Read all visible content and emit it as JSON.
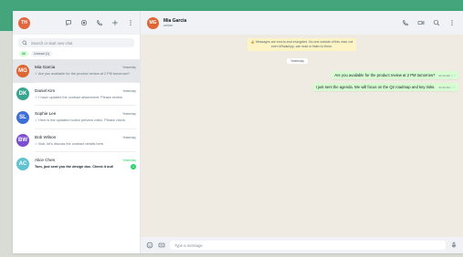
{
  "colors": {
    "brand_band": "#44a57c",
    "accent_green": "#25d366",
    "outgoing_bubble": "#d9fdd3"
  },
  "profile": {
    "initials": "TH",
    "color": "#e2673f"
  },
  "sidebar_icons": [
    "communities-icon",
    "status-icon",
    "calls-icon",
    "new-chat-icon",
    "menu-icon"
  ],
  "search": {
    "placeholder": "Search or start new chat"
  },
  "filters": [
    {
      "label": "All",
      "active": true
    },
    {
      "label": "Unread (1)",
      "active": false
    }
  ],
  "chats": [
    {
      "initials": "MG",
      "color": "#dd6633",
      "name": "Mia Garcia",
      "time": "Yesterday",
      "preview": "✓ Are you available for the product review at 2 PM tomorrow?",
      "selected": true
    },
    {
      "initials": "DK",
      "color": "#3aa58f",
      "name": "Daniel Kim",
      "time": "Yesterday",
      "preview": "✓ I have updated the contract attachment. Please review."
    },
    {
      "initials": "SL",
      "color": "#3f6fd6",
      "name": "Sophie Lee",
      "time": "Yesterday",
      "preview": "✓ Here is the updated motion preview video. Please check."
    },
    {
      "initials": "BW",
      "color": "#7a4fd0",
      "name": "Bob Wilson",
      "time": "Yesterday",
      "preview": "✓ Bob, let's discuss the contract details here."
    },
    {
      "initials": "AC",
      "color": "#5fc4cf",
      "name": "Alice Chen",
      "time": "Yesterday",
      "preview": "Tom, just sent you the design doc. Check it out!",
      "unread": "1"
    }
  ],
  "active_chat": {
    "initials": "MG",
    "color": "#dd6633",
    "name": "Mia Garcia",
    "status": "online",
    "header_icons": [
      "phone-icon",
      "video-icon",
      "search-icon",
      "menu-icon"
    ]
  },
  "encryption_notice": "🔒 Messages are end-to-end encrypted. No one outside of this chat, not even WhatsApp, can read or listen to them.",
  "date_label": "Yesterday",
  "messages": [
    {
      "text": "Are you available for the product review at 2 PM tomorrow?",
      "time": "02:40 AM",
      "ticks": "✓✓"
    },
    {
      "text": "I just sent the agenda. We will focus on the Q2 roadmap and key risks.",
      "time": "02:40 AM",
      "ticks": "✓✓"
    }
  ],
  "composer": {
    "placeholder": "Type a message"
  }
}
